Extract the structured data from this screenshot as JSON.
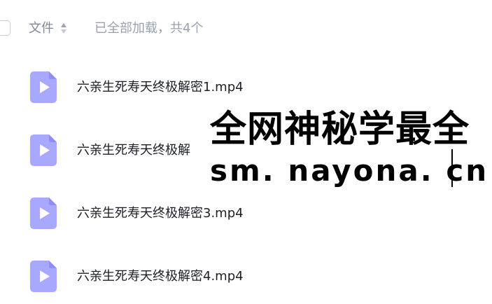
{
  "header": {
    "column_title": "文件",
    "load_status": "已全部加载，共4个"
  },
  "files": [
    {
      "name": "六亲生死寿天终极解密1.mp4",
      "type": "video"
    },
    {
      "name": "六亲生死寿天终极解",
      "type": "video"
    },
    {
      "name": "六亲生死寿天终极解密3.mp4",
      "type": "video"
    },
    {
      "name": "六亲生死寿天终极解密4.mp4",
      "type": "video"
    }
  ],
  "watermark": {
    "line1": "全网神秘学最全",
    "line2": "sm. nayona. cn"
  },
  "colors": {
    "icon_fill": "#a9a8ff",
    "icon_fold": "#8f8df5",
    "text_primary": "#1c1f27",
    "text_secondary": "#818999"
  }
}
